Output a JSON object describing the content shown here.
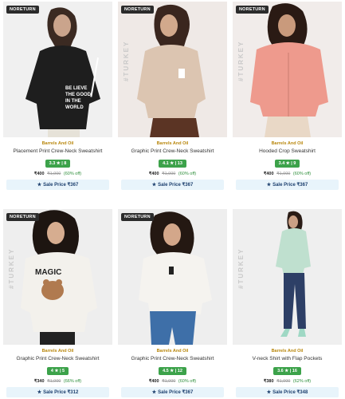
{
  "products": [
    {
      "badge": "NORETURN",
      "watermark": "",
      "brand": "Barrels And Oil",
      "name": "Placement Print Crew-Neck Sweatshirt",
      "rating": "3.3 ★ | 8",
      "price": "₹400",
      "mrp": "₹1,000",
      "off": "(60% off)",
      "sale": "Sale Price ₹367",
      "garment_color": "#1e1e1e",
      "print_text": "BE LIEVE THE GOOD IN THE WORLD"
    },
    {
      "badge": "NORETURN",
      "watermark": "#TURKEY",
      "brand": "Barrels And Oil",
      "name": "Graphic Print Crew-Neck Sweatshirt",
      "rating": "4.1 ★ | 13",
      "price": "₹400",
      "mrp": "₹1,000",
      "off": "(60% off)",
      "sale": "Sale Price ₹367",
      "garment_color": "#dcc5b1"
    },
    {
      "badge": "NORETURN",
      "watermark": "#TURKEY",
      "brand": "Barrels And Oil",
      "name": "Hooded Crop Sweatshirt",
      "rating": "3.4 ★ | 9",
      "price": "₹400",
      "mrp": "₹1,000",
      "off": "(60% off)",
      "sale": "Sale Price ₹367",
      "garment_color": "#ee9a8d"
    },
    {
      "badge": "NORETURN",
      "watermark": "#TURKEY",
      "brand": "Barrels And Oil",
      "name": "Graphic Print Crew-Neck Sweatshirt",
      "rating": "4 ★ | 5",
      "price": "₹340",
      "mrp": "₹1,000",
      "off": "(66% off)",
      "sale": "Sale Price ₹312",
      "garment_color": "#f3f1ec",
      "print_text": "MAGIC"
    },
    {
      "badge": "NORETURN",
      "watermark": "",
      "brand": "Barrels And Oil",
      "name": "Graphic Print Crew-Neck Sweatshirt",
      "rating": "4.5 ★ | 12",
      "price": "₹400",
      "mrp": "₹1,000",
      "off": "(60% off)",
      "sale": "Sale Price ₹367",
      "garment_color": "#f5f3ef"
    },
    {
      "badge": "",
      "watermark": "#TURKEY",
      "brand": "Barrels And Oil",
      "name": "V-neck Shirt with Flap Pockets",
      "rating": "3.6 ★ | 16",
      "price": "₹380",
      "mrp": "₹1,000",
      "off": "(62% off)",
      "sale": "Sale Price ₹348",
      "garment_color": "#bfe0cf"
    }
  ]
}
